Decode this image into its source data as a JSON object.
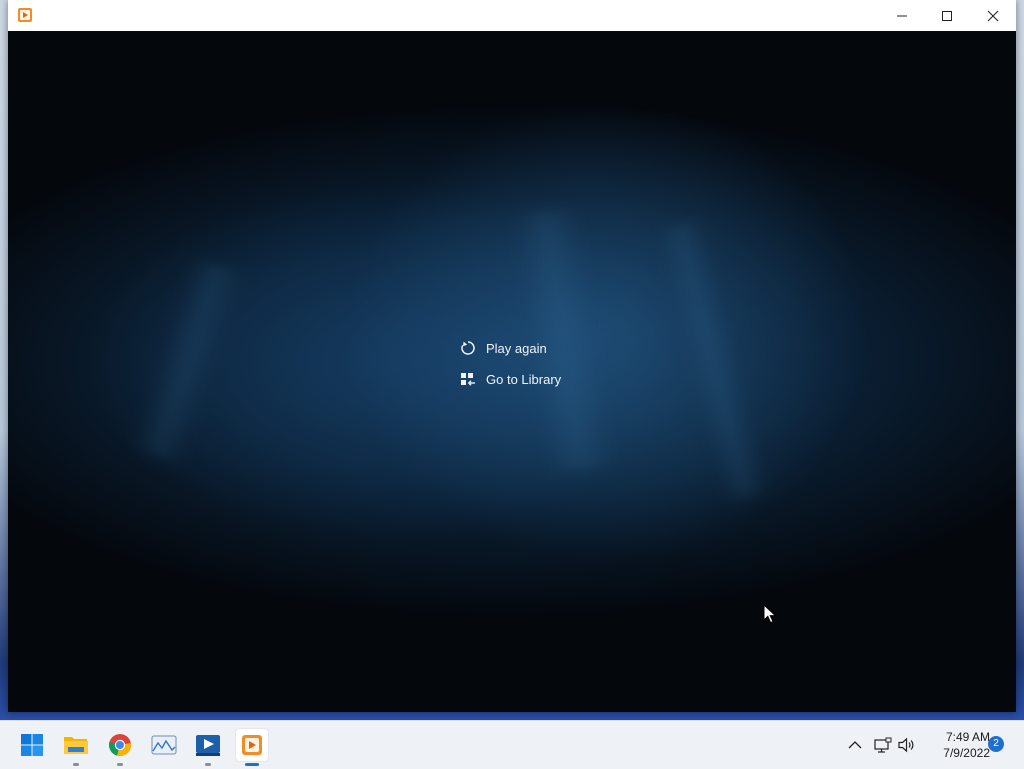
{
  "window": {
    "title": "",
    "app_icon": "media-player-icon",
    "controls": [
      "minimize",
      "maximize",
      "close"
    ]
  },
  "player": {
    "menu": [
      {
        "label": "Play again",
        "icon": "replay-icon"
      },
      {
        "label": "Go to Library",
        "icon": "library-icon"
      }
    ]
  },
  "taskbar": {
    "apps": [
      {
        "name": "Start",
        "icon": "windows-start-icon",
        "running": false
      },
      {
        "name": "File Explorer",
        "icon": "folder-icon",
        "running": true
      },
      {
        "name": "Google Chrome",
        "icon": "chrome-icon",
        "running": true
      },
      {
        "name": "Photos",
        "icon": "photos-icon",
        "running": false
      },
      {
        "name": "Movies & TV",
        "icon": "movies-tv-icon",
        "running": true
      },
      {
        "name": "Media Player",
        "icon": "media-player-icon",
        "running": true,
        "active": true
      }
    ],
    "tray": {
      "icons": [
        "chevron-up-icon",
        "network-icon",
        "volume-icon"
      ],
      "time": "7:49 AM",
      "date": "7/9/2022",
      "notifications": "2"
    }
  },
  "colors": {
    "accent": "#1f6fd1",
    "titlebar": "#ffffff",
    "taskbar": "#eef2f7"
  }
}
